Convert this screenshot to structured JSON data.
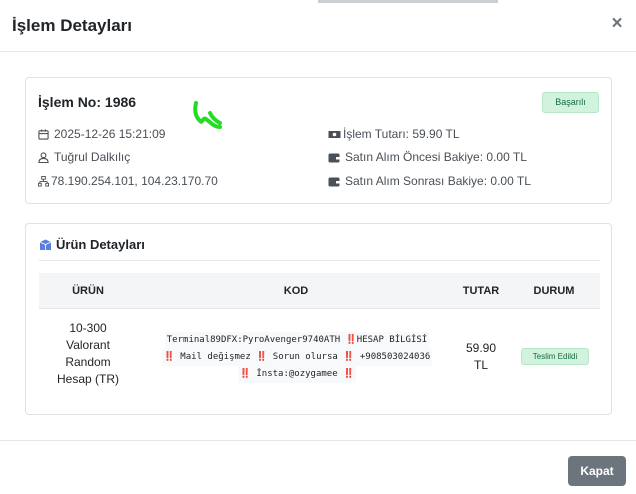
{
  "modal": {
    "title": "İşlem Detayları",
    "close_symbol": "×",
    "footer_button": "Kapat"
  },
  "transaction": {
    "number_label": "İşlem No: 1986",
    "status": "Başarılı",
    "datetime": "2025-12-26 15:21:09",
    "customer": "Tuğrul Dalkılıç",
    "ip": "78.190.254.101, 104.23.170.70",
    "amount": "İşlem Tutarı: 59.90 TL",
    "balance_before": "Satın Alım Öncesi Bakiye: 0.00 TL",
    "balance_after": "Satın Alım Sonrası Bakiye: 0.00 TL"
  },
  "products": {
    "title": "Ürün Detayları",
    "headers": [
      "ÜRÜN",
      "KOD",
      "TUTAR",
      "DURUM"
    ],
    "rows": [
      {
        "name_lines": [
          "10-300",
          "Valorant",
          "Random",
          "Hesap (TR)"
        ],
        "code_lines": [
          "Terminal89DFX:PyroAvenger9740ATH ‼️HESAP BİLGİSİ",
          "‼️ Mail değişmez ‼️ Sorun olursa ‼️ +908503024036",
          "‼️ İnsta:@ozygamee ‼️"
        ],
        "amount_lines": [
          "59.90",
          "TL"
        ],
        "status": "Teslim Edildi"
      }
    ]
  },
  "colors": {
    "success_bg": "#d1f2dc",
    "success_text": "#146c43",
    "button_secondary": "#6c757d",
    "signature": "#22dd22"
  },
  "icons": {
    "close": "close-icon",
    "date": "calendar-icon",
    "user": "user-icon",
    "ip": "network-icon",
    "amount": "money-icon",
    "wallet": "wallet-icon",
    "products": "box-icon"
  }
}
